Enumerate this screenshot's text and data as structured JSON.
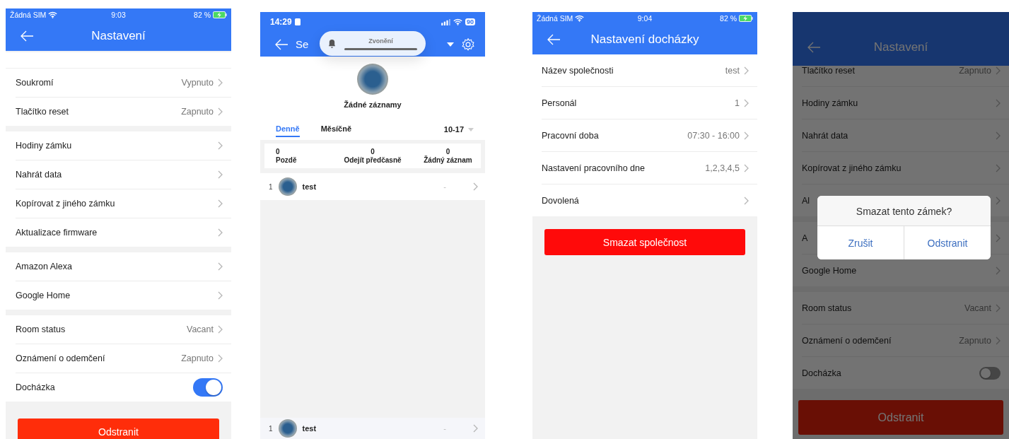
{
  "screens": [
    {
      "kind": "settings",
      "status_bar": {
        "carrier": "Žádná SIM",
        "time": "9:03",
        "battery": "82 %"
      },
      "title": "Nastavení",
      "dimmed": false,
      "groups": [
        [
          {
            "kind": "link",
            "label": "Soukromí",
            "value": "Vypnuto"
          },
          {
            "kind": "link",
            "label": "Tlačítko reset",
            "value": "Zapnuto"
          }
        ],
        [
          {
            "kind": "link",
            "label": "Hodiny zámku"
          },
          {
            "kind": "link",
            "label": "Nahrát data"
          },
          {
            "kind": "link",
            "label": "Kopírovat z jiného zámku"
          },
          {
            "kind": "link",
            "label": "Aktualizace firmware"
          }
        ],
        [
          {
            "kind": "link",
            "label": "Amazon Alexa"
          },
          {
            "kind": "link",
            "label": "Google Home"
          }
        ],
        [
          {
            "kind": "link",
            "label": "Room status",
            "value": "Vacant"
          },
          {
            "kind": "link",
            "label": "Oznámení o odemčení",
            "value": "Zapnuto"
          },
          {
            "kind": "toggle",
            "label": "Docházka",
            "on": true
          }
        ]
      ],
      "delete_button": "Odstranit"
    },
    {
      "kind": "attendance",
      "status_bar": {
        "time": "14:29",
        "battery": "90"
      },
      "title": "Se",
      "notification": {
        "label": "Zvonění"
      },
      "summary": "Žádné záznamy",
      "tabs": [
        {
          "label": "Denně",
          "selected": true
        },
        {
          "label": "Měsíčně",
          "selected": false
        }
      ],
      "date": "10-17",
      "stats": [
        {
          "value": "0",
          "label": "Pozdě"
        },
        {
          "value": "0",
          "label": "Odejít předčasně"
        },
        {
          "value": "0",
          "label": "Žádný záznam"
        }
      ],
      "records": [
        {
          "index": "1",
          "name": "test",
          "value": "-"
        }
      ],
      "footer_record": {
        "index": "1",
        "name": "test",
        "value": "-"
      }
    },
    {
      "kind": "settings",
      "status_bar": {
        "carrier": "Žádná SIM",
        "time": "9:04",
        "battery": "82 %"
      },
      "title": "Nastavení docházky",
      "dimmed": false,
      "groups": [
        [
          {
            "kind": "link",
            "label": "Název společnosti",
            "value": "test"
          },
          {
            "kind": "link",
            "label": "Personál",
            "value": "1"
          },
          {
            "kind": "link",
            "label": "Pracovní doba",
            "value": "07:30 - 16:00"
          },
          {
            "kind": "link",
            "label": "Nastavení pracovního dne",
            "value": "1,2,3,4,5"
          },
          {
            "kind": "link",
            "label": "Dovolená"
          }
        ]
      ],
      "delete_button": "Smazat společnost"
    },
    {
      "kind": "settings",
      "title": "Nastavení",
      "dimmed": true,
      "groups": [
        [
          {
            "kind": "link",
            "label": "Tlačítko reset",
            "value": "Zapnuto"
          },
          {
            "kind": "link",
            "label": "Hodiny zámku"
          },
          {
            "kind": "link",
            "label": "Nahrát data"
          },
          {
            "kind": "link",
            "label": "Kopírovat z jiného zámku"
          },
          {
            "kind": "link",
            "label": "Al"
          }
        ],
        [
          {
            "kind": "link",
            "label": "A"
          },
          {
            "kind": "link",
            "label": "Google Home"
          }
        ],
        [
          {
            "kind": "link",
            "label": "Room status",
            "value": "Vacant"
          },
          {
            "kind": "link",
            "label": "Oznámení o odemčení",
            "value": "Zapnuto"
          },
          {
            "kind": "toggle",
            "label": "Docházka",
            "on": false
          }
        ]
      ],
      "delete_button": "Odstranit",
      "dialog": {
        "message": "Smazat tento zámek?",
        "buttons": [
          {
            "label": "Zrušit"
          },
          {
            "label": "Odstranit"
          }
        ]
      }
    }
  ]
}
